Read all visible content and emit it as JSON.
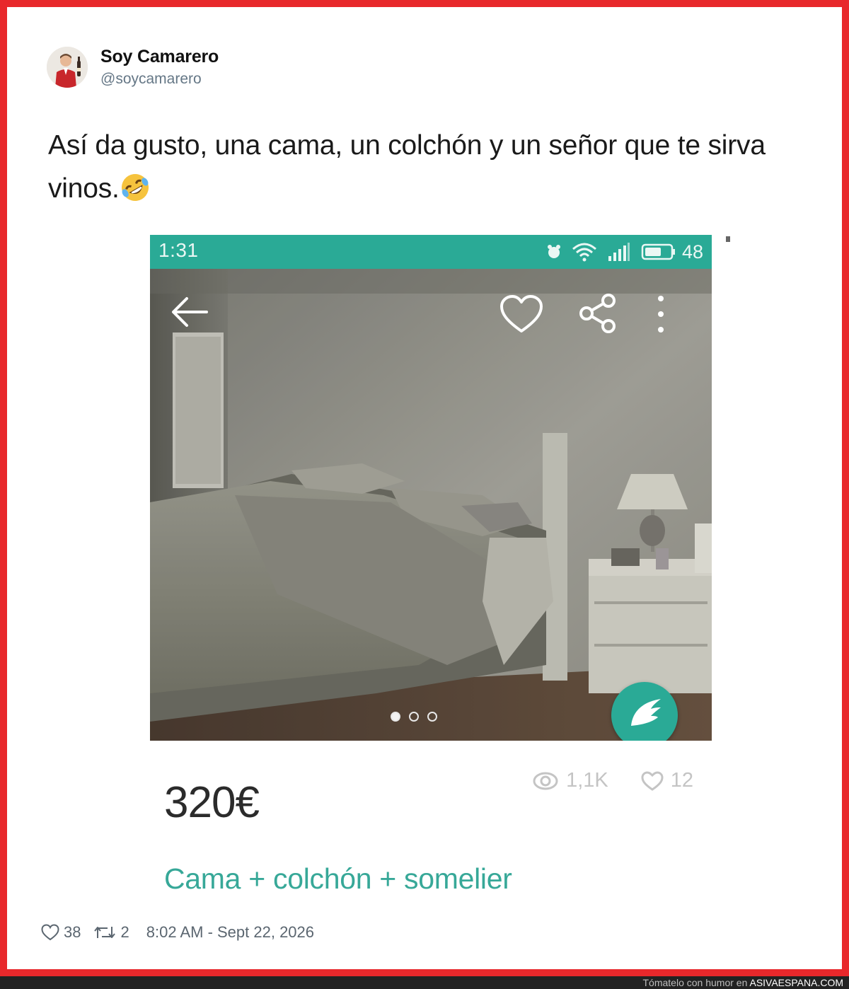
{
  "tweet": {
    "display_name": "Soy Camarero",
    "handle": "@soycamarero",
    "text": "Así da gusto, una cama, un colchón y un señor que te sirva vinos.",
    "emoji_icon": "rolling-on-floor-laughing-emoji",
    "likes": "38",
    "retweets": "2",
    "timestamp": "8:02 AM - Sept 22, 2026"
  },
  "listing_screenshot": {
    "status_bar": {
      "time": "1:31",
      "battery": "48",
      "icons": [
        "alarm-icon",
        "wifi-icon",
        "signal-icon",
        "battery-icon"
      ],
      "color": "#2aaa96"
    },
    "photo_overlay_icons": [
      "back-arrow-icon",
      "heart-icon",
      "share-icon",
      "more-options-icon"
    ],
    "carousel": {
      "total": 3,
      "active": 0
    },
    "price": "320€",
    "views": "1,1K",
    "favorites": "12",
    "title": "Cama + colchón + somelier",
    "accent_color": "#37a898"
  },
  "footer": {
    "credit_prefix": "Tómatelo con humor en",
    "credit_site": "ASIVAESPANA.COM",
    "frame_color": "#e8282b"
  }
}
